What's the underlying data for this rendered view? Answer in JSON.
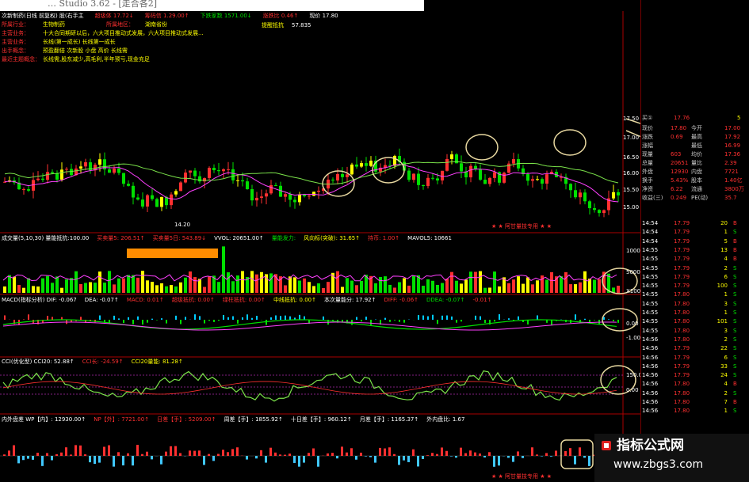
{
  "window": {
    "title": "… Studio 3.62 - [走合各2]"
  },
  "header": {
    "line1": [
      "次新制药(日线 前复权)  股(右手主",
      "超级体  17.72↓",
      "筹码信  1.29.00↑",
      "下跌家数  1571.00↓",
      "涨跌比  0.46↑",
      "现价  17.80"
    ],
    "info_rows": [
      {
        "label": "所属行业：",
        "value": "生物制药",
        "label2": "所属地区：",
        "value2": "湖南省份"
      },
      {
        "label": "主营业务：",
        "value": "十大合同期研以后，六大项目推动式发展，六大项目推动式发展..."
      },
      {
        "label": "主营业务：",
        "value": "长线(第一成长) 长线第一成长"
      },
      {
        "label": "出手概念：",
        "value": "预盈翻倍 次新股 小盘 高价 长线需"
      },
      {
        "label": "最近主题概念：",
        "value": "长线需,股东减少,高毛利,半年预亏,现金充足"
      }
    ],
    "annotations": [
      "提醒抵抗",
      "57.835",
      "14.20"
    ]
  },
  "panels": {
    "volume": [
      "成交量(5,10,30) 量能抵抗:100.00",
      "买卖量5: 206.51↑",
      "买卖量5日: 543.89↓",
      "VVOL: 20651.00↑",
      "量能发力:",
      "风向标(突破): 31.65↑",
      "持币: 1.00↑",
      "MAVOL5: 10661"
    ],
    "volume_axis": [
      "10000",
      "5000",
      "X100"
    ],
    "macd": [
      "MACD(指标分析) DIF: -0.067",
      "DEA: -0.07↑",
      "MACD: 0.01↑",
      "超级抵抗: 0.00↑",
      "绿柱抵抗: 0.00↑",
      "中线抵抗: 0.00↑",
      "本次量能分: 17.92↑",
      "DIFF: -0.06↑",
      "DDEA: -0.07↑",
      "-0.01↑"
    ],
    "macd_axis": [
      "0.00",
      "-1.00"
    ],
    "cci": [
      "CCI(优化型) CCI20: 52.88↑",
      "CCI长: -24.59↑",
      "CCI20量能: 81.28↑"
    ],
    "cci_axis": [
      "150.00",
      "0.00"
    ],
    "flow": [
      "内外盘差  WP【内】: 12930.00↑",
      "NP【外】: 7721.00↑",
      "日差【手】: 5209.00↑",
      "周差【手】: 1855.92↑",
      "十日差【手】: 960.12↑",
      "月差【手】: 1165.37↑",
      "外内盘比: 1.67"
    ],
    "chart_note": "★ ★ 阿甘量技专用 ★ ★"
  },
  "price_axis": [
    "17.50",
    "17.00",
    "16.50",
    "16.00",
    "15.50",
    "15.00"
  ],
  "quote": {
    "top": [
      {
        "l": "买①",
        "v": "17.76",
        "n": "5"
      }
    ],
    "rows": [
      {
        "l": "现价",
        "v": "17.80",
        "l2": "今开",
        "v2": "17.00"
      },
      {
        "l": "涨跌",
        "v": "0.69",
        "l2": "最高",
        "v2": "17.92"
      },
      {
        "l": "涨幅",
        "v": "",
        "l2": "最低",
        "v2": "16.99"
      },
      {
        "l": "现量",
        "v": "603",
        "l2": "均价",
        "v2": "17.36"
      },
      {
        "l": "总量",
        "v": "20651",
        "l2": "量比",
        "v2": "2.39"
      },
      {
        "l": "外盘",
        "v": "12930",
        "l2": "内盘",
        "v2": "7721"
      },
      {
        "l": "换手",
        "v": "5.43%",
        "l2": "股本",
        "v2": "1.40亿"
      },
      {
        "l": "净资",
        "v": "6.22",
        "l2": "流通",
        "v2": "3800万"
      },
      {
        "l": "收益(三)",
        "v": "0.249",
        "l2": "PE(动)",
        "v2": "35.7"
      }
    ],
    "ticks": [
      {
        "t": "14:54",
        "p": "17.79",
        "n": "20",
        "d": "B"
      },
      {
        "t": "14:54",
        "p": "17.79",
        "n": "1",
        "d": "S"
      },
      {
        "t": "14:54",
        "p": "17.79",
        "n": "5",
        "d": "B"
      },
      {
        "t": "14:55",
        "p": "17.79",
        "n": "13",
        "d": "B"
      },
      {
        "t": "14:55",
        "p": "17.79",
        "n": "4",
        "d": "B"
      },
      {
        "t": "14:55",
        "p": "17.79",
        "n": "2",
        "d": "S"
      },
      {
        "t": "14:55",
        "p": "17.79",
        "n": "6",
        "d": "S"
      },
      {
        "t": "14:55",
        "p": "17.79",
        "n": "100",
        "d": "S"
      },
      {
        "t": "14:55",
        "p": "17.80",
        "n": "1",
        "d": "S"
      },
      {
        "t": "14:55",
        "p": "17.80",
        "n": "3",
        "d": "S"
      },
      {
        "t": "14:55",
        "p": "17.80",
        "n": "1",
        "d": "S"
      },
      {
        "t": "14:55",
        "p": "17.80",
        "n": "101",
        "d": "S"
      },
      {
        "t": "14:55",
        "p": "17.80",
        "n": "3",
        "d": "S"
      },
      {
        "t": "14:56",
        "p": "17.80",
        "n": "2",
        "d": "S"
      },
      {
        "t": "14:56",
        "p": "17.79",
        "n": "22",
        "d": "S"
      },
      {
        "t": "14:56",
        "p": "17.79",
        "n": "6",
        "d": "S"
      },
      {
        "t": "14:56",
        "p": "17.79",
        "n": "33",
        "d": "S"
      },
      {
        "t": "14:56",
        "p": "17.79",
        "n": "24",
        "d": "S"
      },
      {
        "t": "14:56",
        "p": "17.80",
        "n": "4",
        "d": "B"
      },
      {
        "t": "14:56",
        "p": "17.80",
        "n": "2",
        "d": "S"
      },
      {
        "t": "14:56",
        "p": "17.80",
        "n": "7",
        "d": "B"
      },
      {
        "t": "14:56",
        "p": "17.80",
        "n": "1",
        "d": "S"
      }
    ]
  },
  "brand": {
    "title": "指标公式网",
    "url": "www.zbgs3.com"
  },
  "colors": {
    "up": "#ff3030",
    "down": "#00e000",
    "highlight": "#ffff00",
    "circle": "#e8d8a0"
  }
}
